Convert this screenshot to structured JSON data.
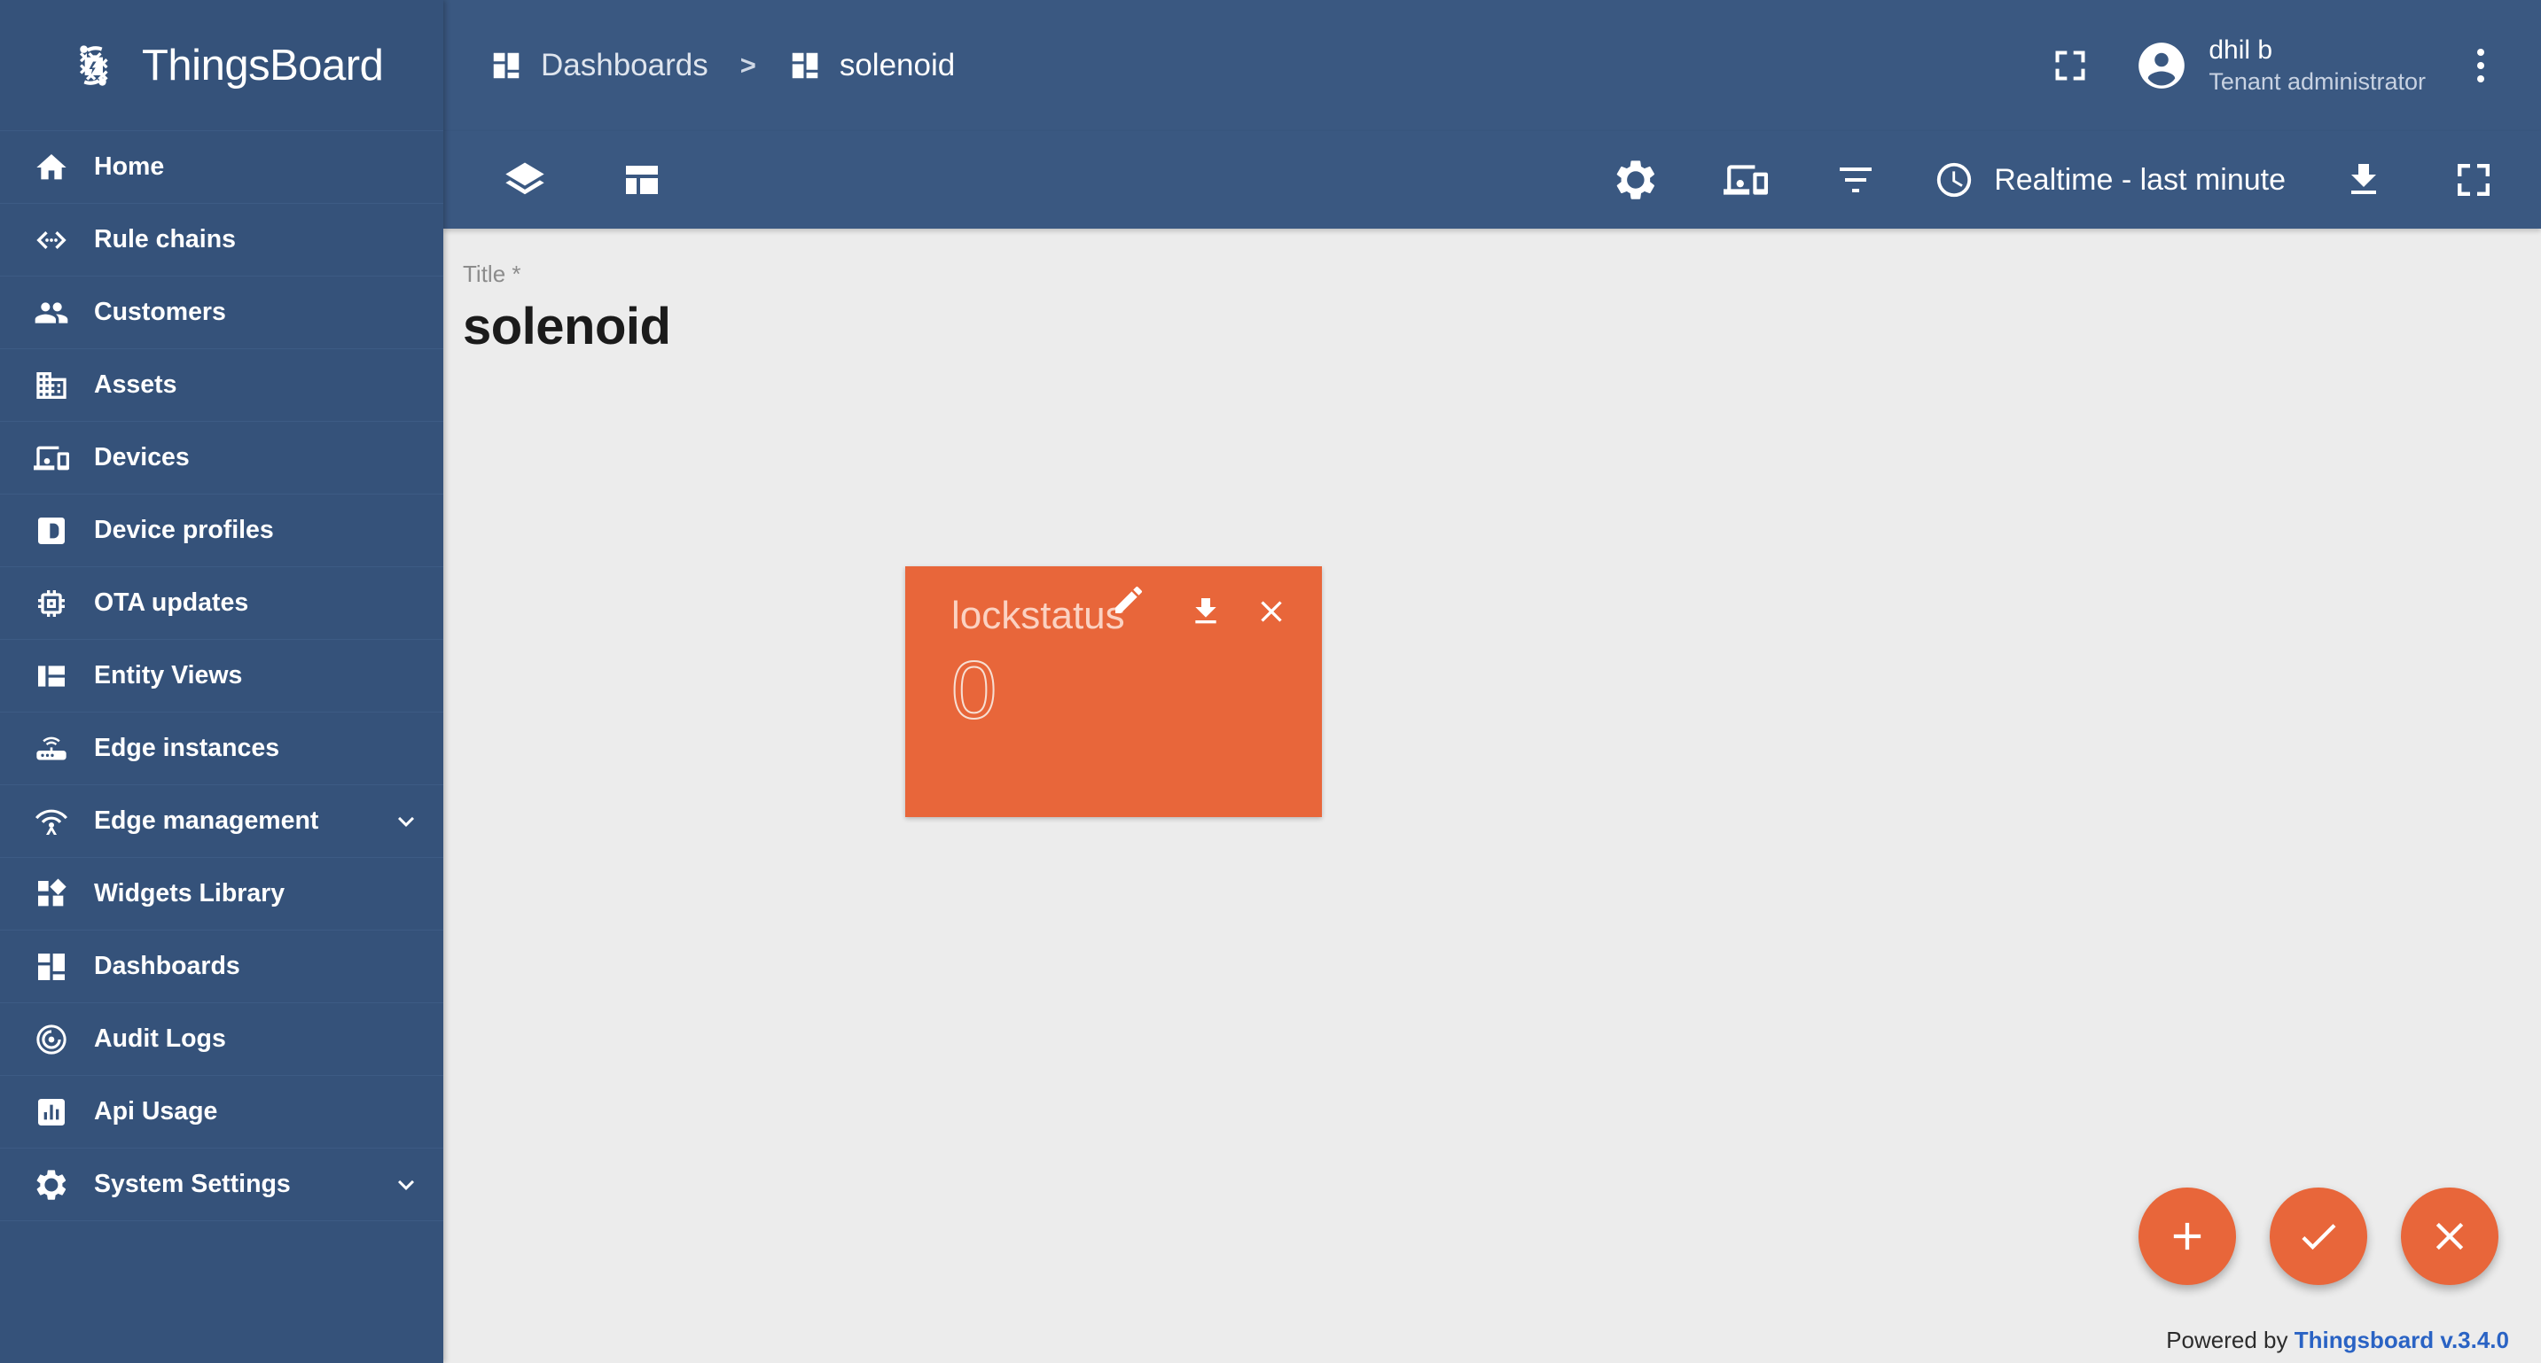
{
  "brand": {
    "name": "ThingsBoard",
    "logo_icon": "thingsboard-logo-icon"
  },
  "sidebar": {
    "items": [
      {
        "label": "Home",
        "icon": "home-icon",
        "expandable": false
      },
      {
        "label": "Rule chains",
        "icon": "rule-chains-icon",
        "expandable": false
      },
      {
        "label": "Customers",
        "icon": "customers-icon",
        "expandable": false
      },
      {
        "label": "Assets",
        "icon": "assets-icon",
        "expandable": false
      },
      {
        "label": "Devices",
        "icon": "devices-icon",
        "expandable": false
      },
      {
        "label": "Device profiles",
        "icon": "device-profiles-icon",
        "expandable": false
      },
      {
        "label": "OTA updates",
        "icon": "ota-updates-icon",
        "expandable": false
      },
      {
        "label": "Entity Views",
        "icon": "entity-views-icon",
        "expandable": false
      },
      {
        "label": "Edge instances",
        "icon": "edge-instances-icon",
        "expandable": false
      },
      {
        "label": "Edge management",
        "icon": "edge-management-icon",
        "expandable": true
      },
      {
        "label": "Widgets Library",
        "icon": "widgets-library-icon",
        "expandable": false
      },
      {
        "label": "Dashboards",
        "icon": "dashboards-icon",
        "expandable": false
      },
      {
        "label": "Audit Logs",
        "icon": "audit-logs-icon",
        "expandable": false
      },
      {
        "label": "Api Usage",
        "icon": "api-usage-icon",
        "expandable": false
      },
      {
        "label": "System Settings",
        "icon": "system-settings-icon",
        "expandable": true
      }
    ]
  },
  "topbar": {
    "breadcrumb": {
      "parent": "Dashboards",
      "separator": ">",
      "current": "solenoid",
      "parent_icon": "dashboards-icon",
      "current_icon": "dashboards-icon"
    },
    "fullscreen_icon": "fullscreen-icon",
    "avatar_icon": "account-circle-icon",
    "user_name": "dhil b",
    "user_role": "Tenant administrator",
    "menu_icon": "kebab-menu-icon"
  },
  "dashboard_toolbar": {
    "layers_icon": "layers-icon",
    "layout_icon": "dashboard-layout-icon",
    "settings_icon": "gear-icon",
    "states_icon": "device-states-icon",
    "filters_icon": "filter-icon",
    "timerange_icon": "clock-icon",
    "timerange_label": "Realtime - last minute",
    "export_icon": "download-icon",
    "fullscreen_icon": "fullscreen-icon"
  },
  "main": {
    "title_label": "Title *",
    "title_value": "solenoid"
  },
  "widget": {
    "title": "lockstatus",
    "value": "0",
    "edit_icon": "pencil-icon",
    "download_icon": "download-icon",
    "close_icon": "close-icon",
    "background_color": "#e8663a"
  },
  "fabs": [
    {
      "name": "add-widget-button",
      "icon": "plus-icon"
    },
    {
      "name": "apply-changes-button",
      "icon": "check-icon"
    },
    {
      "name": "cancel-changes-button",
      "icon": "close-icon"
    }
  ],
  "footer": {
    "prefix": "Powered by ",
    "link": "Thingsboard v.3.4.0"
  },
  "colors": {
    "sidebar": "#35527a",
    "topbar": "#3a5881",
    "accent_orange": "#e8663a",
    "page_bg": "#ececec",
    "link_blue": "#2a63c4"
  }
}
